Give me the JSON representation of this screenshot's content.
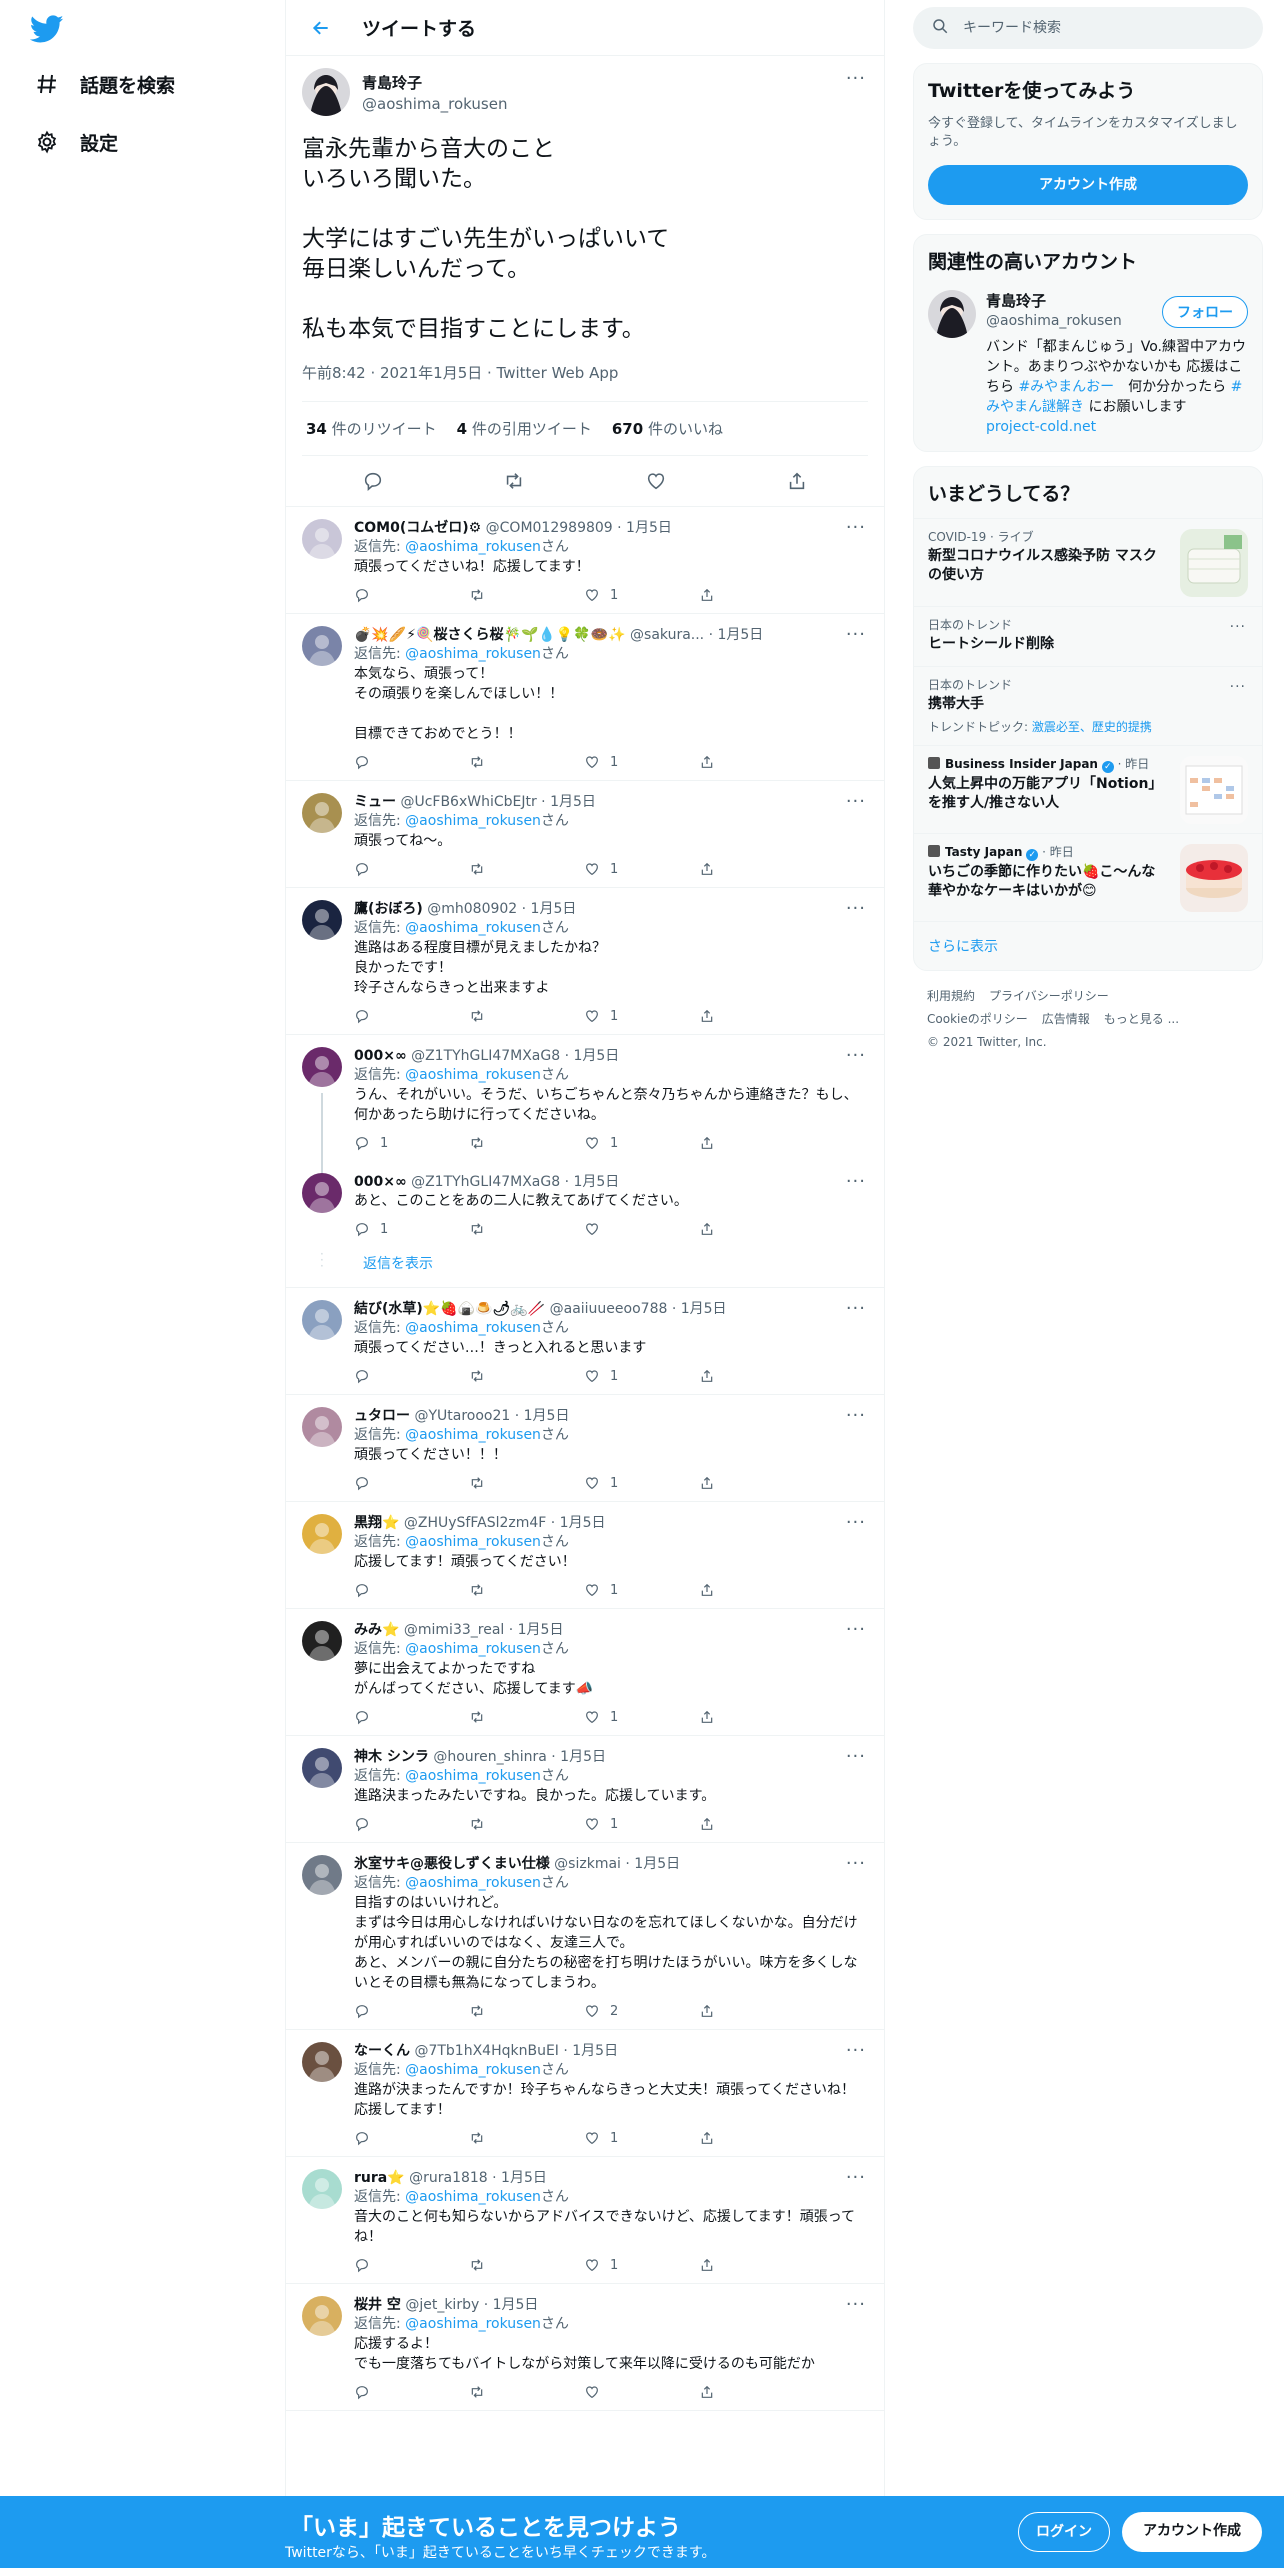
{
  "nav": {
    "explore_label": "話題を検索",
    "settings_label": "設定"
  },
  "header": {
    "title": "ツイートする"
  },
  "main_tweet": {
    "name": "青島玲子",
    "handle": "@aoshima_rokusen",
    "text": "富永先輩から音大のこと\nいろいろ聞いた。\n\n大学にはすごい先生がいっぱいいて\n毎日楽しいんだって。\n\n私も本気で目指すことにします。",
    "meta": "午前8:42 · 2021年1月5日 · Twitter Web App",
    "retweets": "34",
    "retweets_label": " 件のリツイート",
    "quotes": "4",
    "quotes_label": " 件の引用ツイート",
    "likes": "670",
    "likes_label": " 件のいいね"
  },
  "replying_prefix": "返信先: ",
  "replying_user": "@aoshima_rokusen",
  "replying_suffix": "さん",
  "replies": [
    {
      "name": "COM0(コムゼロ)⚙",
      "meta": " @COM012989809 · 1月5日",
      "text": "頑張ってくださいね！応援してます！",
      "replying": true,
      "replies": "",
      "retweets": "",
      "likes": "1",
      "avatar": "#c9c6d8"
    },
    {
      "name": "💣💥🥖⚡🍭桜さくら桜🎋🌱💧💡🍀🍩✨",
      "meta": " @sakura... · 1月5日",
      "text": "本気なら、頑張って！\nその頑張りを楽しんでほしい！！\n\n目標できておめでとう！！",
      "replying": true,
      "replies": "",
      "retweets": "",
      "likes": "1",
      "avatar": "#7a84a8"
    },
    {
      "name": "ミュー",
      "meta": " @UcFB6xWhiCbEJtr · 1月5日",
      "text": "頑張ってね〜。",
      "replying": true,
      "replies": "",
      "retweets": "",
      "likes": "1",
      "avatar": "#a89050"
    },
    {
      "name": "鷹(おぼろ)",
      "meta": " @mh080902 · 1月5日",
      "text": "進路はある程度目標が見えましたかね？\n良かったです！\n玲子さんならきっと出来ますよ",
      "replying": true,
      "replies": "",
      "retweets": "",
      "likes": "1",
      "avatar": "#1a2440"
    },
    {
      "name": "000×∞",
      "meta": " @Z1TYhGLI47MXaG8 · 1月5日",
      "text": "うん、それがいい。そうだ、いちごちゃんと奈々乃ちゃんから連絡きた？もし、何かあったら助けに行ってくださいね。",
      "replying": true,
      "replies": "1",
      "retweets": "",
      "likes": "1",
      "avatar": "#6a2a6a",
      "thread": true
    },
    {
      "name": "000×∞",
      "meta": " @Z1TYhGLI47MXaG8 · 1月5日",
      "text": "あと、このことをあの二人に教えてあげてください。",
      "replying": false,
      "replies": "1",
      "retweets": "",
      "likes": "",
      "avatar": "#6a2a6a",
      "noborder": true
    },
    {
      "name": "結び(水草)⭐🍓🍙🍮🌶🚲🥢",
      "meta": " @aaiiuueeoo788 · 1月5日",
      "text": "頑張ってください…！きっと入れると思います",
      "replying": true,
      "replies": "",
      "retweets": "",
      "likes": "1",
      "avatar": "#8aa0c0"
    },
    {
      "name": "ュタロー",
      "meta": " @YUtarooo21 · 1月5日",
      "text": "頑張ってください！！！",
      "replying": true,
      "replies": "",
      "retweets": "",
      "likes": "1",
      "avatar": "#b08aa0"
    },
    {
      "name": "黒翔⭐",
      "meta": " @ZHUySfFASl2zm4F · 1月5日",
      "text": "応援してます！頑張ってください！",
      "replying": true,
      "replies": "",
      "retweets": "",
      "likes": "1",
      "avatar": "#e0b040"
    },
    {
      "name": "みみ⭐",
      "meta": " @mimi33_real · 1月5日",
      "text": "夢に出会えてよかったですね\nがんばってください、応援してます📣",
      "replying": true,
      "replies": "",
      "retweets": "",
      "likes": "1",
      "avatar": "#202020"
    },
    {
      "name": "神木 シンラ",
      "meta": " @houren_shinra · 1月5日",
      "text": "進路決まったみたいですね。良かった。応援しています。",
      "replying": true,
      "replies": "",
      "retweets": "",
      "likes": "1",
      "avatar": "#404a70"
    },
    {
      "name": "氷室サキ@悪役しずくまい仕様",
      "meta": " @sizkmai · 1月5日",
      "text": "目指すのはいいけれど。\nまずは今日は用心しなければいけない日なのを忘れてほしくないかな。自分だけが用心すればいいのではなく、友達三人で。\nあと、メンバーの親に自分たちの秘密を打ち明けたほうがいい。味方を多くしないとその目標も無為になってしまうわ。",
      "replying": true,
      "replies": "",
      "retweets": "",
      "likes": "2",
      "avatar": "#707a88"
    },
    {
      "name": "なーくん",
      "meta": " @7Tb1hX4HqknBuEI · 1月5日",
      "text": "進路が決まったんですか！玲子ちゃんならきっと大丈夫！頑張ってくださいね！応援してます！",
      "replying": true,
      "replies": "",
      "retweets": "",
      "likes": "1",
      "avatar": "#6a5040"
    },
    {
      "name": "rura⭐",
      "meta": " @rura1818 · 1月5日",
      "text": "音大のこと何も知らないからアドバイスできないけど、応援してます！頑張ってね！",
      "replying": true,
      "replies": "",
      "retweets": "",
      "likes": "1",
      "avatar": "#a8dcd0"
    },
    {
      "name": "桜井 空",
      "meta": " @jet_kirby · 1月5日",
      "text": "応援するよ！\nでも一度落ちてもバイトしながら対策して来年以降に受けるのも可能だか",
      "replying": true,
      "replies": "",
      "retweets": "",
      "likes": "",
      "avatar": "#d8b060"
    }
  ],
  "show_replies_label": "返信を表示",
  "search": {
    "placeholder": "キーワード検索"
  },
  "signup_box": {
    "title": "Twitterを使ってみよう",
    "subtitle": "今すぐ登録して、タイムラインをカスタマイズしましょう。",
    "button": "アカウント作成"
  },
  "related": {
    "title": "関連性の高いアカウント",
    "name": "青島玲子",
    "handle": "@aoshima_rokusen",
    "follow": "フォロー",
    "bio_1": "バンド「都まんじゅう」Vo.練習中アカウント。あまりつぶやかないかも 応援はこちら ",
    "bio_tag1": "#みやまんおー",
    "bio_2": "　何か分かったら ",
    "bio_tag2": "#みやまん謎解き",
    "bio_3": " にお願いします　",
    "bio_link": "project-cold.net"
  },
  "trends": {
    "title": "いまどうしてる？",
    "items": [
      {
        "cat": "COVID-19 · ライブ",
        "title": "新型コロナウイルス感染予防 マスクの使い方",
        "sub": "",
        "thumb": "mask"
      },
      {
        "cat": "日本のトレンド",
        "title": "ヒートシールド削除",
        "sub": "",
        "dots": true
      },
      {
        "cat": "日本のトレンド",
        "title": "携帯大手",
        "sub_prefix": "トレンドトピック: ",
        "sub_link": "激震必至、歴史的提携",
        "dots": true
      },
      {
        "cat": "Business Insider Japan",
        "cat_suffix": " · 昨日",
        "title": "人気上昇中の万能アプリ「Notion」を推す人/推さない人",
        "thumb": "notion",
        "verified": true
      },
      {
        "cat": "Tasty Japan",
        "cat_suffix": " · 昨日",
        "title": "いちごの季節に作りたい🍓こ〜んな華やかなケーキはいかが😊",
        "thumb": "cake",
        "verified": true
      }
    ],
    "show_more": "さらに表示"
  },
  "footer": {
    "terms": "利用規約",
    "privacy": "プライバシーポリシー",
    "cookie": "Cookieのポリシー",
    "ads": "広告情報",
    "more": "もっと見る ...",
    "copyright": "© 2021 Twitter, Inc."
  },
  "bottom_bar": {
    "headline": "「いま」起きていることを見つけよう",
    "sub": "Twitterなら、「いま」起きていることをいち早くチェックできます。",
    "login": "ログイン",
    "signup": "アカウント作成"
  },
  "colors": {
    "accent": "#1d9bf0",
    "text": "#0f1419",
    "muted": "#536471"
  }
}
